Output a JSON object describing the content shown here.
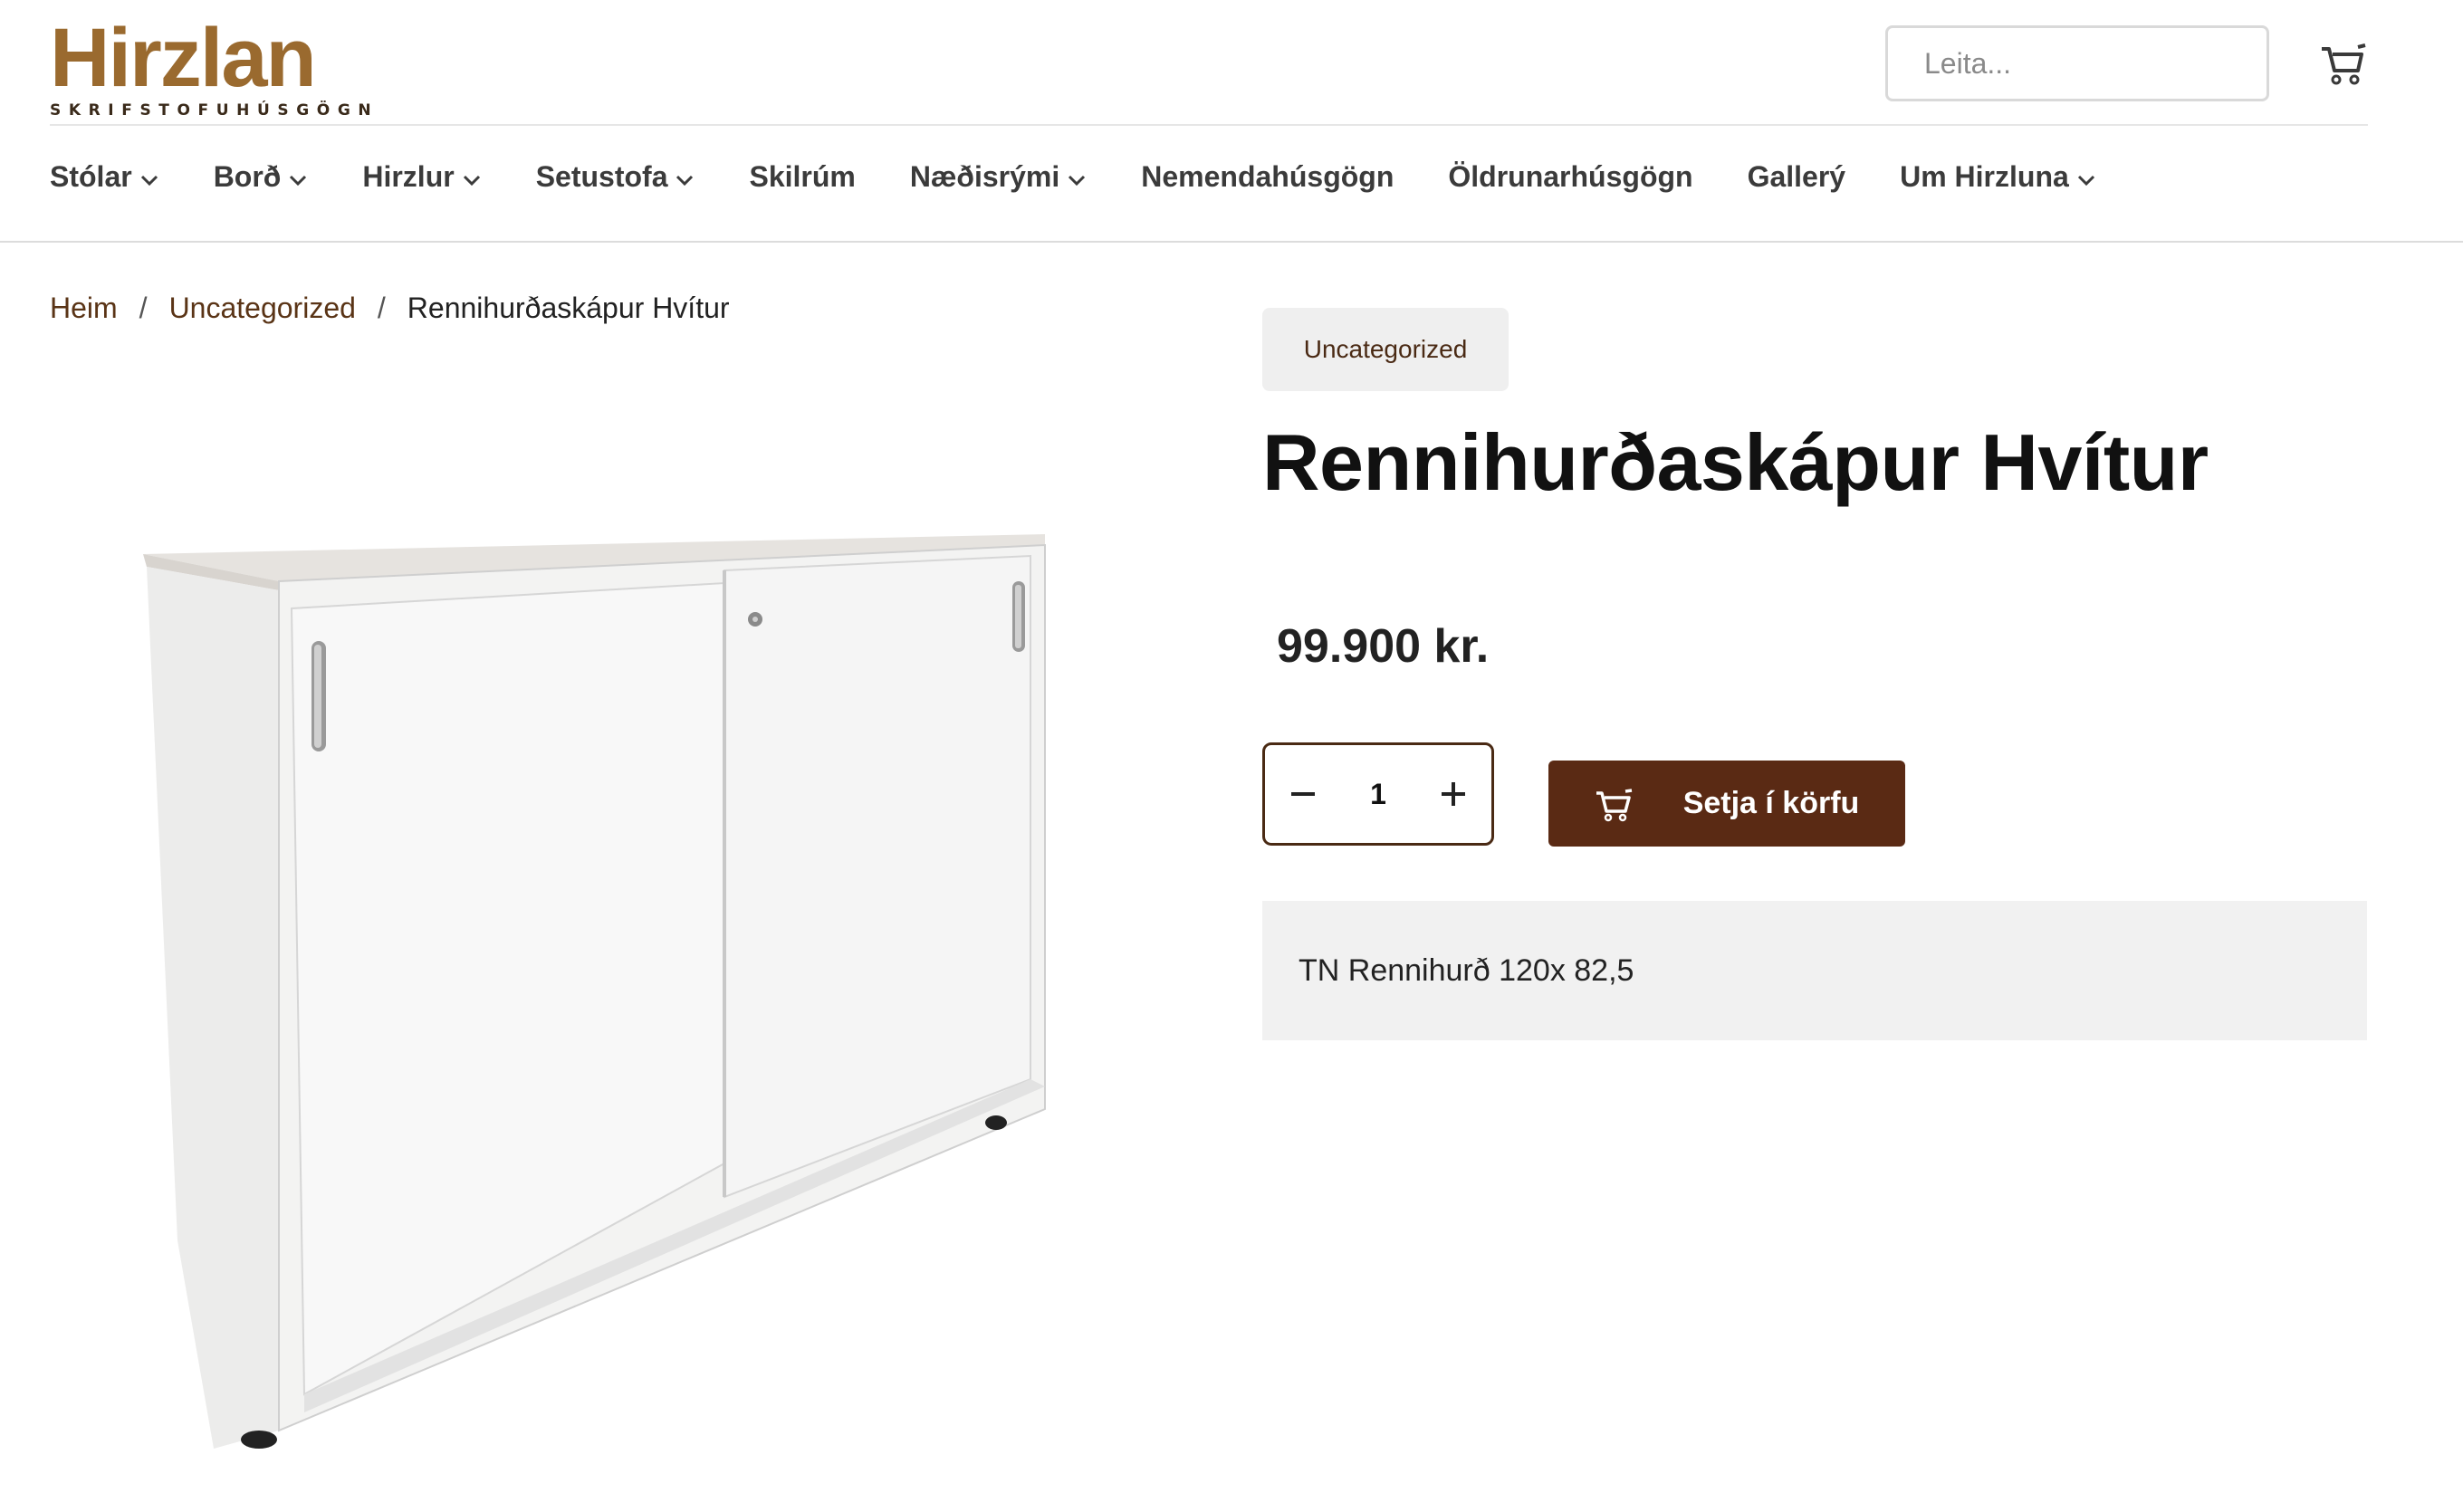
{
  "brand": {
    "name": "Hirzlan",
    "tagline": "SKRIFSTOFUHÚSGÖGN",
    "color": "#9a6a2f"
  },
  "search": {
    "placeholder": "Leita..."
  },
  "header": {
    "cart_icon": "cart-icon"
  },
  "nav": {
    "items": [
      {
        "label": "Stólar",
        "dropdown": true
      },
      {
        "label": "Borð",
        "dropdown": true
      },
      {
        "label": "Hirzlur",
        "dropdown": true
      },
      {
        "label": "Setustofa",
        "dropdown": true
      },
      {
        "label": "Skilrúm",
        "dropdown": false
      },
      {
        "label": "Næðisrými",
        "dropdown": true
      },
      {
        "label": "Nemendahúsgögn",
        "dropdown": false
      },
      {
        "label": "Öldrunarhúsgögn",
        "dropdown": false
      },
      {
        "label": "Gallerý",
        "dropdown": false
      },
      {
        "label": "Um Hirzluna",
        "dropdown": true
      }
    ]
  },
  "breadcrumb": {
    "items": [
      "Heim",
      "Uncategorized"
    ],
    "separator": "/",
    "current": "Rennihurðaskápur Hvítur"
  },
  "product": {
    "category": "Uncategorized",
    "title": "Rennihurðaskápur Hvítur",
    "price": "99.900 kr.",
    "quantity": "1",
    "add_to_cart_label": "Setja í körfu",
    "description": "TN Rennihurð 120x 82,5"
  },
  "colors": {
    "accent": "#5a2a14",
    "link": "#5a3416",
    "badge_bg": "#efefef",
    "desc_bg": "#f1f1f1"
  }
}
